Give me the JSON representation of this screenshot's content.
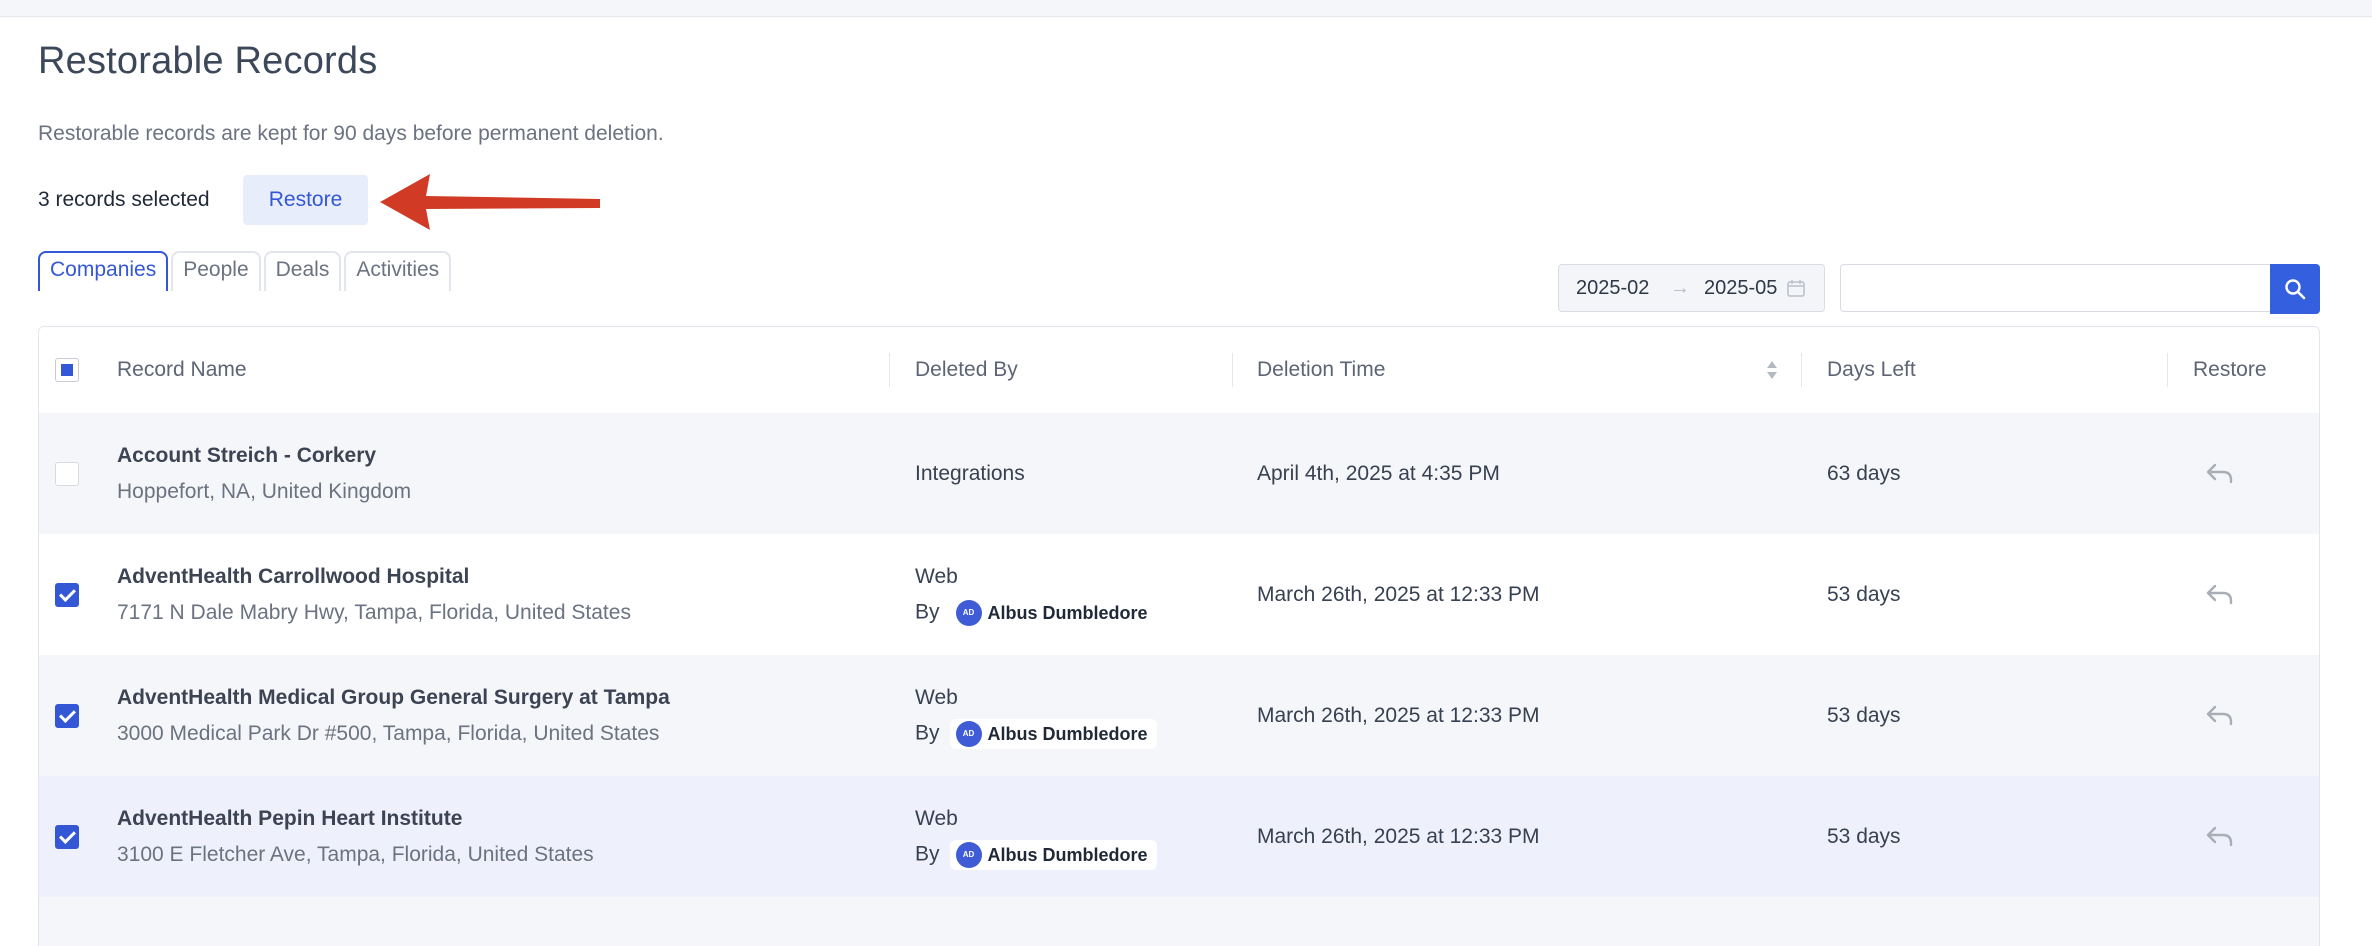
{
  "page": {
    "title": "Restorable Records",
    "subtitle": "Restorable records are kept for 90 days before permanent deletion."
  },
  "selection": {
    "count_label": "3 records selected",
    "restore_label": "Restore"
  },
  "tabs": [
    {
      "label": "Companies",
      "active": true
    },
    {
      "label": "People",
      "active": false
    },
    {
      "label": "Deals",
      "active": false
    },
    {
      "label": "Activities",
      "active": false
    }
  ],
  "filters": {
    "date_start": "2025-02",
    "date_end": "2025-05",
    "date_separator": "→",
    "search_value": ""
  },
  "table": {
    "headers": {
      "record_name": "Record Name",
      "deleted_by": "Deleted By",
      "deletion_time": "Deletion Time",
      "days_left": "Days Left",
      "restore": "Restore"
    },
    "by_prefix": "By",
    "rows": [
      {
        "name": "Account Streich - Corkery",
        "address": "Hoppefort, NA, United Kingdom",
        "deleted_by": "Integrations",
        "deletion_time": "April 4th, 2025 at 4:35 PM",
        "days_left": "63 days",
        "checked": false
      },
      {
        "name": "AdventHealth Carrollwood Hospital",
        "address": "7171 N Dale Mabry Hwy, Tampa, Florida, United States",
        "deleted_by": "Web",
        "user_initials": "AD",
        "user_name": "Albus Dumbledore",
        "deletion_time": "March 26th, 2025 at 12:33 PM",
        "days_left": "53 days",
        "checked": true
      },
      {
        "name": "AdventHealth Medical Group General Surgery at Tampa",
        "address": "3000 Medical Park Dr #500, Tampa, Florida, United States",
        "deleted_by": "Web",
        "user_initials": "AD",
        "user_name": "Albus Dumbledore",
        "deletion_time": "March 26th, 2025 at 12:33 PM",
        "days_left": "53 days",
        "checked": true
      },
      {
        "name": "AdventHealth Pepin Heart Institute",
        "address": "3100 E Fletcher Ave, Tampa, Florida, United States",
        "deleted_by": "Web",
        "user_initials": "AD",
        "user_name": "Albus Dumbledore",
        "deletion_time": "March 26th, 2025 at 12:33 PM",
        "days_left": "53 days",
        "checked": true
      }
    ]
  },
  "colors": {
    "accent": "#3457d5",
    "annotation_arrow": "#d13b26"
  },
  "icons": {
    "search": "search-icon",
    "calendar": "calendar-icon",
    "sort": "sort-icon",
    "restore": "undo-arrow-icon",
    "annotation": "red-arrow-annotation"
  }
}
